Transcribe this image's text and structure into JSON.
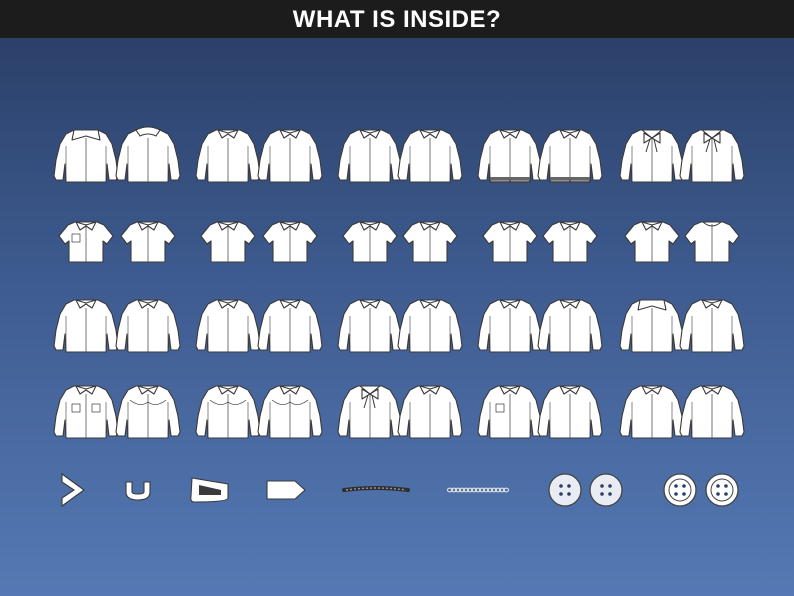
{
  "header": {
    "title": "WHAT IS INSIDE?"
  },
  "colors": {
    "title_bg": "#1c1c1c",
    "title_text": "#ffffff",
    "bg_top": "#283c63",
    "bg_bottom": "#5579b4",
    "garment_fill": "#ffffff",
    "garment_stroke": "#3a3a3a",
    "trim": "#555555",
    "button_fill": "#e9ecf2"
  },
  "rows": [
    {
      "name": "long-sleeve-oversized",
      "garments": [
        {
          "style": "long",
          "collar": "wide",
          "detail": "none"
        },
        {
          "style": "long",
          "collar": "puff",
          "detail": "none"
        },
        {
          "style": "long",
          "collar": "layered",
          "detail": "none"
        },
        {
          "style": "long",
          "collar": "plain",
          "detail": "none"
        },
        {
          "style": "long",
          "collar": "plain",
          "detail": "none"
        },
        {
          "style": "long",
          "collar": "plain",
          "detail": "none"
        },
        {
          "style": "long",
          "collar": "plain",
          "detail": "fringe"
        },
        {
          "style": "long",
          "collar": "plain",
          "detail": "fringe"
        },
        {
          "style": "long",
          "collar": "bow",
          "detail": "none"
        },
        {
          "style": "long",
          "collar": "bow",
          "detail": "none"
        }
      ]
    },
    {
      "name": "short-sleeve",
      "garments": [
        {
          "style": "short",
          "collar": "plain",
          "detail": "pocket"
        },
        {
          "style": "short",
          "collar": "plain",
          "detail": "none"
        },
        {
          "style": "short",
          "collar": "plain",
          "detail": "none"
        },
        {
          "style": "short",
          "collar": "plain",
          "detail": "none"
        },
        {
          "style": "short",
          "collar": "plain",
          "detail": "none"
        },
        {
          "style": "short",
          "collar": "plain",
          "detail": "none"
        },
        {
          "style": "short",
          "collar": "plain",
          "detail": "none"
        },
        {
          "style": "short",
          "collar": "plain",
          "detail": "none"
        },
        {
          "style": "short",
          "collar": "plain",
          "detail": "none"
        },
        {
          "style": "short",
          "collar": "round",
          "detail": "none"
        }
      ]
    },
    {
      "name": "long-sleeve-classic",
      "garments": [
        {
          "style": "long",
          "collar": "plain",
          "detail": "none"
        },
        {
          "style": "long",
          "collar": "plain",
          "detail": "none"
        },
        {
          "style": "long",
          "collar": "plain",
          "detail": "none"
        },
        {
          "style": "long",
          "collar": "plain",
          "detail": "none"
        },
        {
          "style": "long",
          "collar": "plain",
          "detail": "none"
        },
        {
          "style": "long",
          "collar": "plain",
          "detail": "none"
        },
        {
          "style": "long",
          "collar": "plain",
          "detail": "none"
        },
        {
          "style": "long",
          "collar": "plain",
          "detail": "none"
        },
        {
          "style": "long",
          "collar": "wide",
          "detail": "none"
        },
        {
          "style": "long",
          "collar": "plain",
          "detail": "none"
        }
      ]
    },
    {
      "name": "long-sleeve-western",
      "garments": [
        {
          "style": "long",
          "collar": "plain",
          "detail": "pockets"
        },
        {
          "style": "long",
          "collar": "plain",
          "detail": "yoke"
        },
        {
          "style": "long",
          "collar": "plain",
          "detail": "yoke"
        },
        {
          "style": "long",
          "collar": "plain",
          "detail": "yoke"
        },
        {
          "style": "long",
          "collar": "bow",
          "detail": "none"
        },
        {
          "style": "long",
          "collar": "plain",
          "detail": "none"
        },
        {
          "style": "long",
          "collar": "plain",
          "detail": "pocket"
        },
        {
          "style": "long",
          "collar": "plain",
          "detail": "none"
        },
        {
          "style": "long",
          "collar": "plain",
          "detail": "none"
        },
        {
          "style": "long",
          "collar": "plain",
          "detail": "none"
        }
      ]
    }
  ],
  "trims": [
    {
      "name": "dart-chevron",
      "kind": "chevron"
    },
    {
      "name": "loop-hook",
      "kind": "loop"
    },
    {
      "name": "tab-strap",
      "kind": "tab"
    },
    {
      "name": "label-tag",
      "kind": "tag"
    },
    {
      "name": "braided-cord",
      "kind": "cord"
    },
    {
      "name": "chain-trim",
      "kind": "chain"
    },
    {
      "name": "button-4hole-gray",
      "kind": "button",
      "variant": "gray"
    },
    {
      "name": "button-4hole-gray-2",
      "kind": "button",
      "variant": "gray"
    },
    {
      "name": "button-4hole-white",
      "kind": "button",
      "variant": "white"
    },
    {
      "name": "button-4hole-white-2",
      "kind": "button",
      "variant": "white"
    }
  ]
}
